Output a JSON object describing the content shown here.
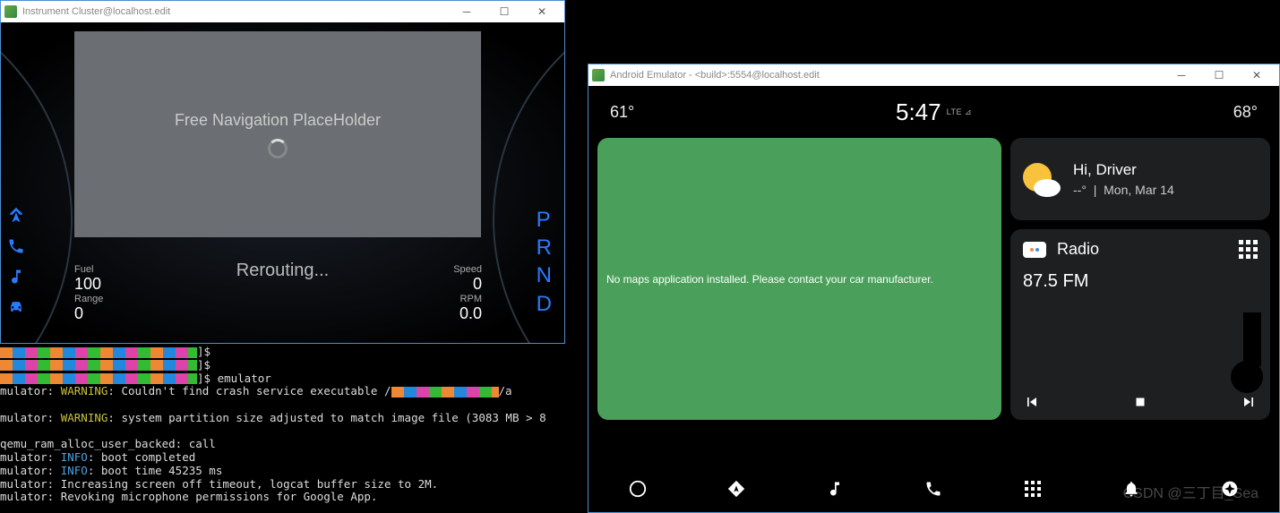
{
  "left_window": {
    "title": "Instrument Cluster@localhost.edit",
    "nav_placeholder": "Free Navigation PlaceHolder",
    "rerouting": "Rerouting...",
    "fuel_label": "Fuel",
    "fuel_value": "100",
    "range_label": "Range",
    "range_value": "0",
    "speed_label": "Speed",
    "speed_value": "0",
    "rpm_label": "RPM",
    "rpm_value": "0.0",
    "gears": {
      "p": "P",
      "r": "R",
      "n": "N",
      "d": "D"
    }
  },
  "terminal": {
    "l1_suffix": "]$",
    "l2_suffix": "]$",
    "l3_cmd": "]$ emulator",
    "l4_pre": "mulator: ",
    "l4_warn": "WARNING",
    "l4_post": ": Couldn't find crash service executable /",
    "l4_end": "/a",
    "l5_pre": "mulator: ",
    "l5_warn": "WARNING",
    "l5_post": ": system partition size adjusted to match image file (3083 MB > 8",
    "l6": "qemu_ram_alloc_user_backed: call",
    "l7_pre": "mulator: ",
    "l7_info": "INFO",
    "l7_post": ": boot completed",
    "l8_pre": "mulator: ",
    "l8_info": "INFO",
    "l8_post": ": boot time 45235 ms",
    "l9": "mulator: Increasing screen off timeout, logcat buffer size to 2M.",
    "l10": "mulator: Revoking microphone permissions for Google App."
  },
  "right_window": {
    "title": "Android Emulator - <build>:5554@localhost.edit",
    "temp_left": "61°",
    "time": "5:47",
    "net": "LTE ⊿",
    "temp_right": "68°",
    "map_message": "No maps application installed. Please contact your car manufacturer.",
    "weather_greeting": "Hi, Driver",
    "weather_temp": "--°",
    "weather_date": "Mon, Mar 14",
    "radio_label": "Radio",
    "radio_freq": "87.5 FM"
  },
  "watermark": "CSDN @三丁目_Sea"
}
